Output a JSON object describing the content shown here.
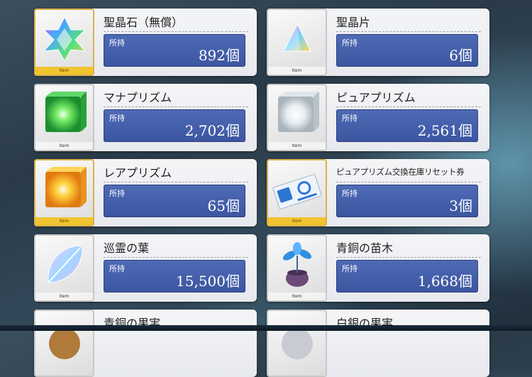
{
  "item_tag": "Item",
  "stock_label": "所持",
  "items": [
    {
      "name": "聖晶石（無償）",
      "count": "892個",
      "icon": "saint-quartz-icon"
    },
    {
      "name": "聖晶片",
      "count": "6個",
      "icon": "saint-quartz-fragment-icon"
    },
    {
      "name": "マナプリズム",
      "count": "2,702個",
      "icon": "mana-prism-icon"
    },
    {
      "name": "ピュアプリズム",
      "count": "2,561個",
      "icon": "pure-prism-icon"
    },
    {
      "name": "レアプリズム",
      "count": "65個",
      "icon": "rare-prism-icon"
    },
    {
      "name": "ピュアプリズム交換在庫リセット券",
      "count": "3個",
      "icon": "reset-ticket-icon"
    },
    {
      "name": "巡霊の葉",
      "count": "15,500個",
      "icon": "leaf-icon"
    },
    {
      "name": "青銅の苗木",
      "count": "1,668個",
      "icon": "bronze-sapling-icon"
    },
    {
      "name": "青銅の果実",
      "count": "",
      "icon": "bronze-fruit-icon"
    },
    {
      "name": "白銀の果実",
      "count": "",
      "icon": "silver-fruit-icon"
    }
  ]
}
